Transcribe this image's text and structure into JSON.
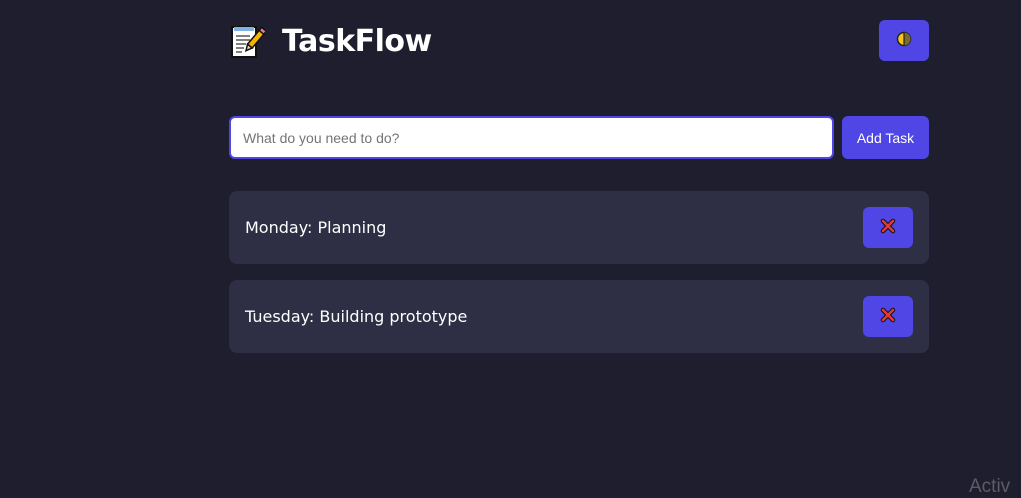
{
  "header": {
    "logo_icon": "memo-pencil-icon",
    "title": "TaskFlow",
    "theme_toggle_icon": "half-moon-icon"
  },
  "input": {
    "placeholder": "What do you need to do?",
    "value": ""
  },
  "add_button": {
    "label": "Add Task"
  },
  "tasks": [
    {
      "text": "Monday: Planning",
      "delete_icon": "close-x-icon"
    },
    {
      "text": "Tuesday: Building prototype",
      "delete_icon": "close-x-icon"
    }
  ],
  "colors": {
    "background": "#1e1e2e",
    "card": "#2e2e45",
    "accent": "#4f46e5",
    "delete_x": "#e53935"
  },
  "watermark": {
    "text": "Activ"
  }
}
